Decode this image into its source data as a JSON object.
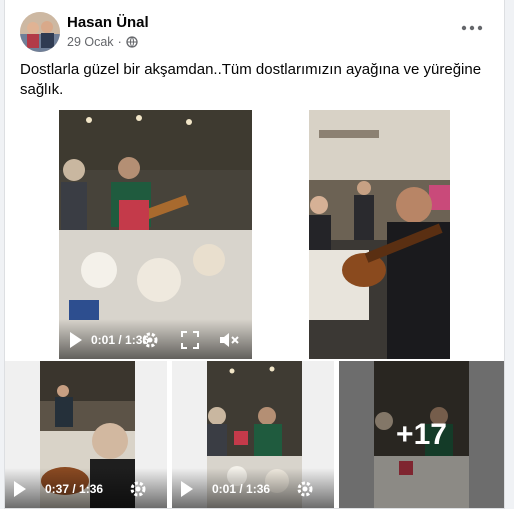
{
  "post": {
    "author": "Hasan Ünal",
    "date": "29 Ocak",
    "separator": "·",
    "privacy_icon": "globe-icon",
    "more_icon": "more-options-icon",
    "caption": "Dostlarla güzel bir akşamdan..Tüm dostlarımızın ayağına ve yüreğine sağlık."
  },
  "media": {
    "video1": {
      "time": "0:01 / 1:36"
    },
    "video3": {
      "time": "0:37 / 1:36"
    },
    "video4": {
      "time": "0:01 / 1:36"
    },
    "more_overlay": {
      "count": "+17"
    }
  },
  "colors": {
    "accent": "#1877f2",
    "text": "#050505",
    "secondary": "#65676b"
  }
}
